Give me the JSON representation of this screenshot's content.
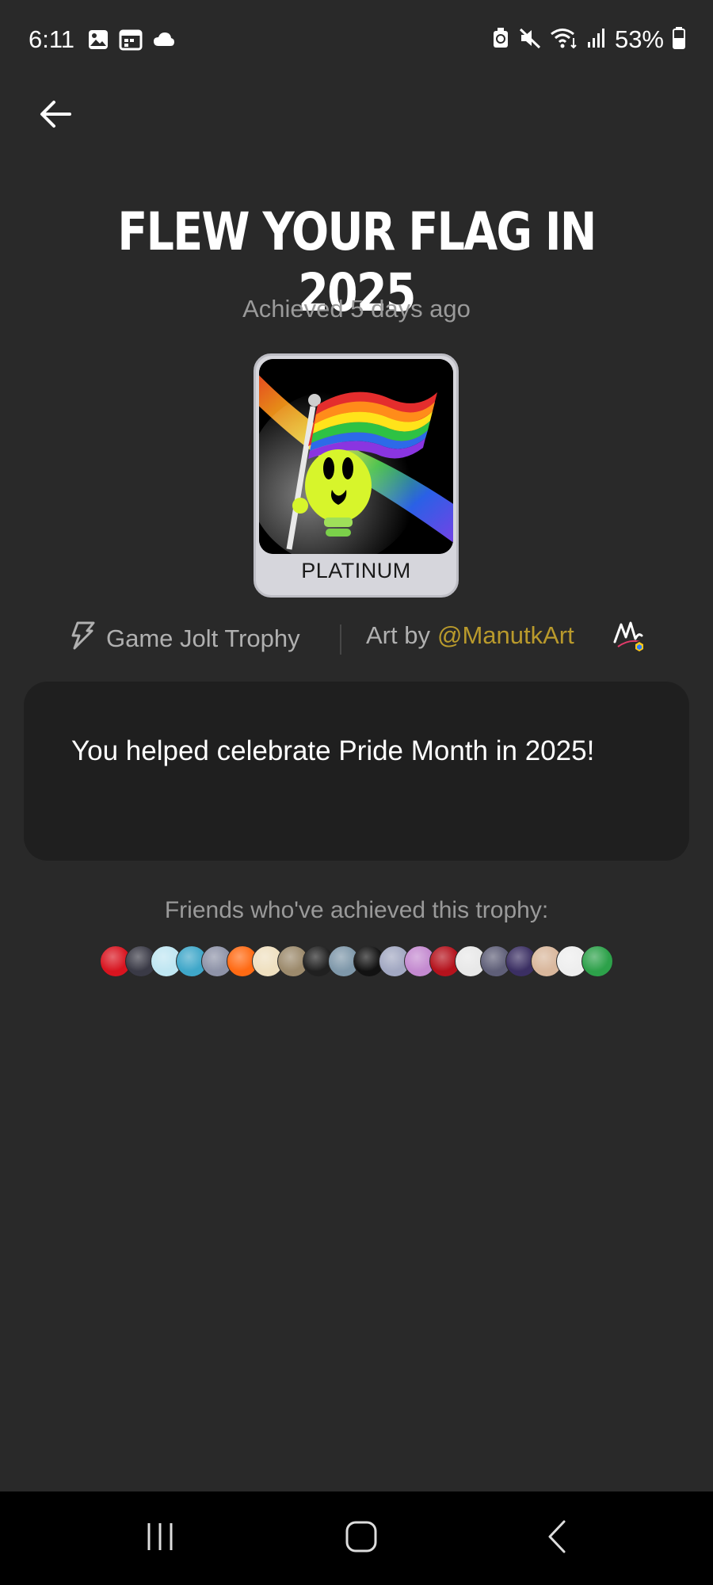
{
  "status_bar": {
    "time": "6:11",
    "battery": "53%",
    "left_icons": [
      "gallery-icon",
      "calendar-icon",
      "cloud-icon"
    ],
    "right_icons": [
      "battery-saver-icon",
      "mute-icon",
      "wifi-icon",
      "signal-icon",
      "battery-icon"
    ]
  },
  "header": {
    "back_icon": "back-arrow-icon"
  },
  "trophy": {
    "title": "FLEW YOUR FLAG IN 2025",
    "achieved": "Achieved 5 days ago",
    "tier": "PLATINUM",
    "source": "Game Jolt Trophy",
    "art_by_prefix": "Art by",
    "artist": "@ManutkArt",
    "description": "You helped celebrate Pride Month in 2025!"
  },
  "friends": {
    "label": "Friends who've achieved this trophy:",
    "avatar_colors": [
      "#d8141f",
      "#3a3a46",
      "#bfe6f2",
      "#3fa7c9",
      "#8e93a8",
      "#ff6a13",
      "#efe0c0",
      "#9c8a6c",
      "#202020",
      "#7f98aa",
      "#121212",
      "#a2a8c2",
      "#c48ad0",
      "#b5121c",
      "#e8e8e8",
      "#5f5f78",
      "#3b2f63",
      "#d9b79c",
      "#eeeeee",
      "#2da14a"
    ]
  },
  "nav_bar": {
    "icons": [
      "recents-icon",
      "home-icon",
      "back-icon"
    ]
  },
  "colors": {
    "background": "#292929",
    "card": "#1f1f1f",
    "artist_link": "#b99a2c",
    "muted_text": "#9a9a9a"
  }
}
